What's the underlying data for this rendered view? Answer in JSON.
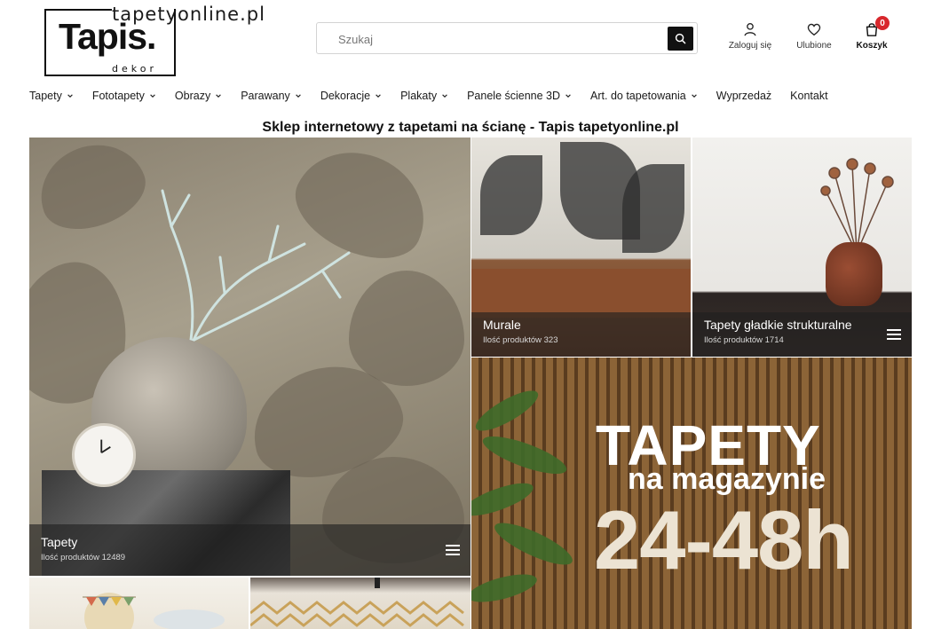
{
  "header": {
    "logo": {
      "domain": "tapetyonline.pl",
      "brand": "Tapis.",
      "sub": "dekor"
    },
    "search": {
      "placeholder": "Szukaj",
      "icon": "search-icon"
    },
    "actions": [
      {
        "label": "Zaloguj się",
        "icon": "user-icon"
      },
      {
        "label": "Ulubione",
        "icon": "heart-icon"
      },
      {
        "label": "Koszyk",
        "icon": "cart-icon",
        "badge": "0"
      }
    ]
  },
  "nav": {
    "items": [
      {
        "label": "Tapety",
        "dropdown": true
      },
      {
        "label": "Fototapety",
        "dropdown": true
      },
      {
        "label": "Obrazy",
        "dropdown": true
      },
      {
        "label": "Parawany",
        "dropdown": true
      },
      {
        "label": "Dekoracje",
        "dropdown": true
      },
      {
        "label": "Plakaty",
        "dropdown": true
      },
      {
        "label": "Panele ścienne 3D",
        "dropdown": true
      },
      {
        "label": "Art. do tapetowania",
        "dropdown": true
      },
      {
        "label": "Wyprzedaż",
        "dropdown": false
      },
      {
        "label": "Kontakt",
        "dropdown": false
      }
    ]
  },
  "main": {
    "title": "Sklep internetowy z tapetami na ścianę - Tapis tapetyonline.pl",
    "tiles": {
      "tapety": {
        "name": "Tapety",
        "count": "Ilość produktów 12489"
      },
      "murale": {
        "name": "Murale",
        "count": "Ilość produktów 323"
      },
      "gladkie": {
        "name": "Tapety gładkie strukturalne",
        "count": "Ilość produktów 1714"
      }
    },
    "promo": {
      "line1": "TAPETY",
      "line2": "na magazynie",
      "line3": "24-48h"
    }
  },
  "colors": {
    "accent": "#111111",
    "badge": "#d8272c"
  }
}
